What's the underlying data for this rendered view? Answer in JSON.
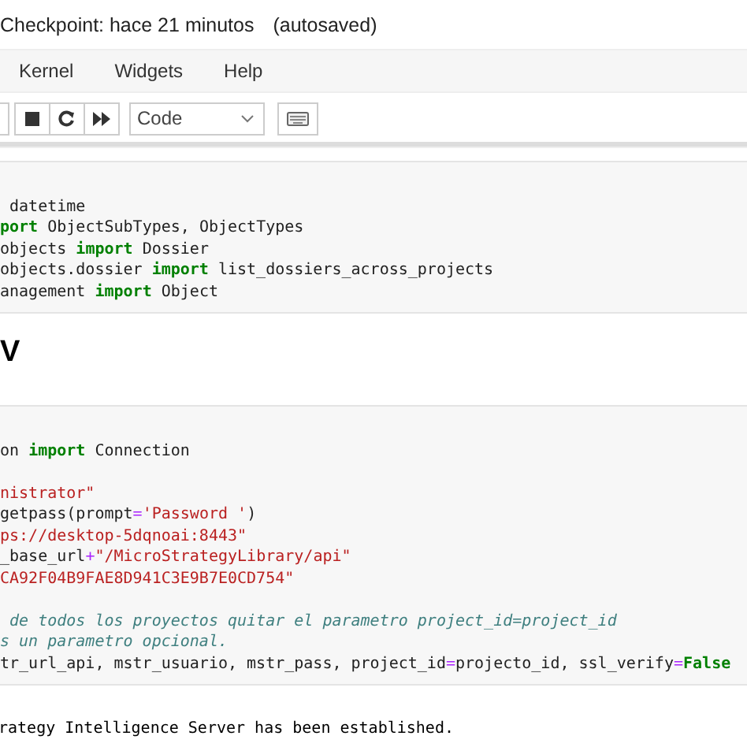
{
  "header": {
    "checkpoint": "Checkpoint: hace 21 minutos",
    "autosave": "(autosaved)"
  },
  "menu": [
    {
      "label": "Kernel"
    },
    {
      "label": "Widgets"
    },
    {
      "label": "Help"
    }
  ],
  "toolbar": {
    "cell_type": "Code"
  },
  "cells": [
    {
      "kind": "code",
      "blocks": [
        [
          [
            {
              "kind": "plain",
              "text": " datetime"
            }
          ],
          [
            {
              "kind": "keyword",
              "text": "port"
            },
            {
              "kind": "plain",
              "text": " ObjectSubTypes, ObjectTypes"
            }
          ],
          [
            {
              "kind": "plain",
              "text": "objects "
            },
            {
              "kind": "keyword",
              "text": "import"
            },
            {
              "kind": "plain",
              "text": " Dossier"
            }
          ],
          [
            {
              "kind": "plain",
              "text": "objects.dossier "
            },
            {
              "kind": "keyword",
              "text": "import"
            },
            {
              "kind": "plain",
              "text": " list_dossiers_across_projects"
            }
          ],
          [
            {
              "kind": "plain",
              "text": "anagement "
            },
            {
              "kind": "keyword",
              "text": "import"
            },
            {
              "kind": "plain",
              "text": " Object"
            }
          ]
        ]
      ]
    },
    {
      "kind": "heading",
      "text": "V"
    },
    {
      "kind": "code",
      "blocks": [
        [
          [
            {
              "kind": "plain",
              "text": "on "
            },
            {
              "kind": "keyword",
              "text": "import"
            },
            {
              "kind": "plain",
              "text": " Connection"
            }
          ]
        ],
        [
          [
            {
              "kind": "string",
              "text": "nistrator\""
            }
          ],
          [
            {
              "kind": "plain",
              "text": "getpass(prompt"
            },
            {
              "kind": "operator",
              "text": "="
            },
            {
              "kind": "string",
              "text": "'Password '"
            },
            {
              "kind": "plain",
              "text": ")"
            }
          ],
          [
            {
              "kind": "string",
              "text": "ps://desktop-5dqnoai:8443\""
            }
          ],
          [
            {
              "kind": "plain",
              "text": "_base_url"
            },
            {
              "kind": "operator",
              "text": "+"
            },
            {
              "kind": "string",
              "text": "\"/MicroStrategyLibrary/api\""
            }
          ],
          [
            {
              "kind": "string",
              "text": "CA92F04B9FAE8D941C3E9B7E0CD754\""
            }
          ]
        ],
        [
          [
            {
              "kind": "comment",
              "text": " de todos los proyectos quitar el parametro project_id=project_id"
            }
          ],
          [
            {
              "kind": "comment",
              "text": "s un parametro opcional."
            }
          ],
          [
            {
              "kind": "plain",
              "text": "tr_url_api, mstr_usuario, mstr_pass, project_id"
            },
            {
              "kind": "operator",
              "text": "="
            },
            {
              "kind": "plain",
              "text": "projecto_id, ssl_verify"
            },
            {
              "kind": "operator",
              "text": "="
            },
            {
              "kind": "keyword",
              "text": "False"
            }
          ]
        ]
      ]
    },
    {
      "kind": "output",
      "text": "rategy Intelligence Server has been established."
    }
  ]
}
